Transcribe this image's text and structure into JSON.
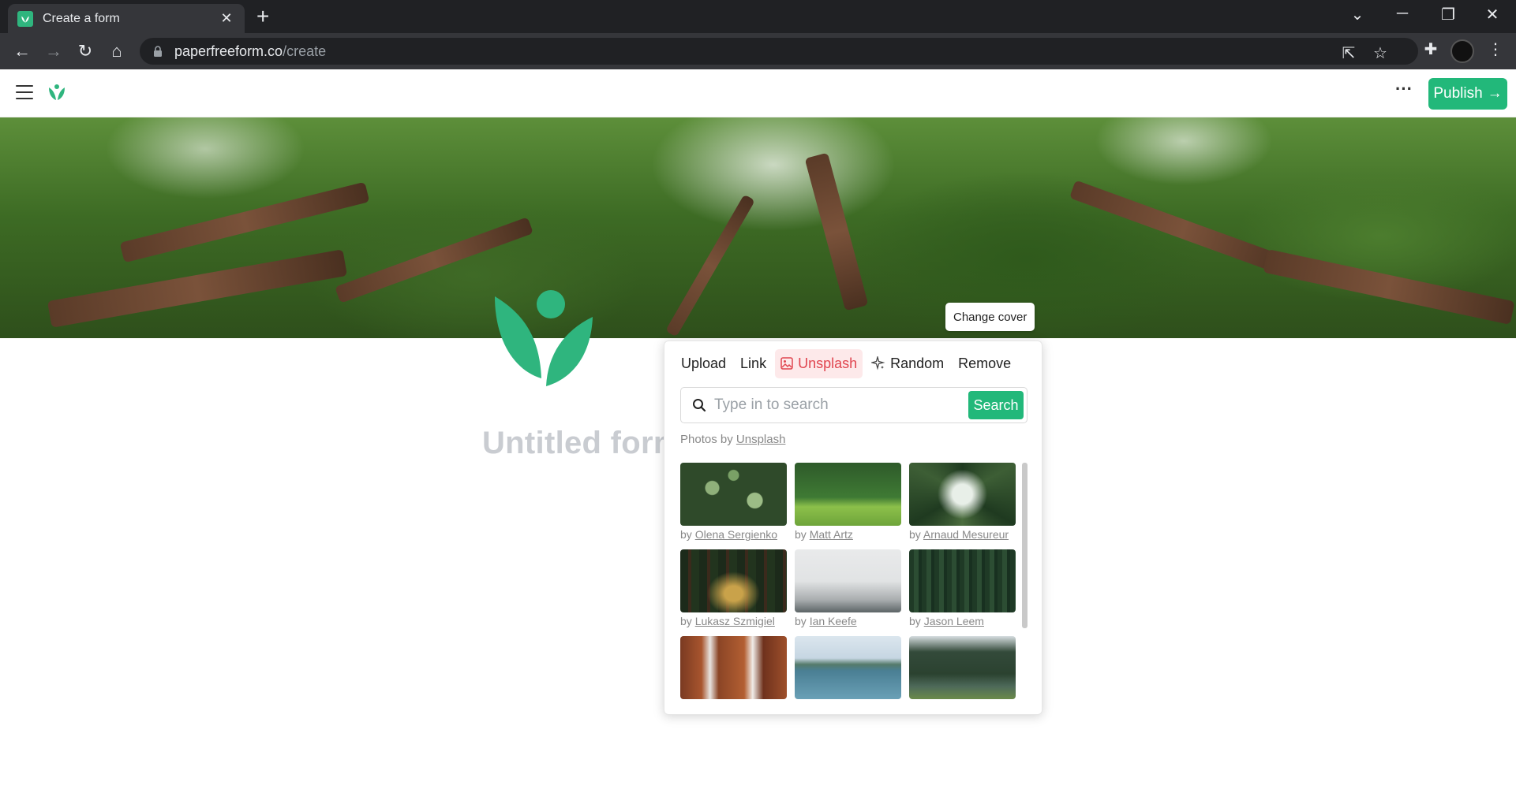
{
  "browser": {
    "tab_title": "Create a form",
    "url_host": "paperfreeform.co",
    "url_path": "/create"
  },
  "header": {
    "publish_label": "Publish",
    "more_label": "···"
  },
  "cover": {
    "change_cover_label": "Change cover"
  },
  "form": {
    "title_placeholder": "Untitled form"
  },
  "popover": {
    "tabs": [
      {
        "label": "Upload",
        "active": false
      },
      {
        "label": "Link",
        "active": false
      },
      {
        "label": "Unsplash",
        "active": true
      },
      {
        "label": "Random",
        "active": false
      },
      {
        "label": "Remove",
        "active": false
      }
    ],
    "search_placeholder": "Type in to search",
    "search_button": "Search",
    "credits_prefix": "Photos by ",
    "credits_link": "Unsplash",
    "photos": [
      {
        "author": "Olena Sergienko",
        "by": "by "
      },
      {
        "author": "Matt Artz",
        "by": "by "
      },
      {
        "author": "Arnaud Mesureur",
        "by": "by "
      },
      {
        "author": "Lukasz Szmigiel",
        "by": "by "
      },
      {
        "author": "Ian Keefe",
        "by": "by "
      },
      {
        "author": "Jason Leem",
        "by": "by "
      }
    ]
  },
  "colors": {
    "accent": "#22b87a",
    "unsplash_active": "#e0454f"
  }
}
